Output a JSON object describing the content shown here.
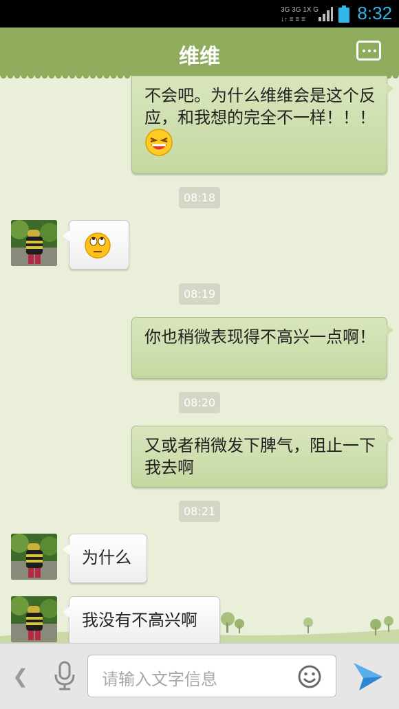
{
  "status_bar": {
    "network_label_top": "3G 3G 1X G",
    "time": "8:32"
  },
  "header": {
    "title": "维维",
    "menu_icon": "more-dots-icon"
  },
  "messages": [
    {
      "type": "outgoing",
      "text": "不会吧。为什么维维会是这个反应，和我想的完全不一样！！！",
      "emoji": "laughing-emoji"
    },
    {
      "type": "timestamp",
      "text": "08:18"
    },
    {
      "type": "incoming",
      "emoji": "eye-roll-emoji"
    },
    {
      "type": "timestamp",
      "text": "08:19"
    },
    {
      "type": "outgoing",
      "text": "你也稍微表现得不高兴一点啊！"
    },
    {
      "type": "timestamp",
      "text": "08:20"
    },
    {
      "type": "outgoing",
      "text": "又或者稍微发下脾气，阻止一下我去啊"
    },
    {
      "type": "timestamp",
      "text": "08:21"
    },
    {
      "type": "incoming",
      "text": "为什么"
    },
    {
      "type": "incoming",
      "text": "我没有不高兴啊"
    }
  ],
  "input_bar": {
    "placeholder": "请输入文字信息",
    "back_icon": "chevron-left-icon",
    "voice_icon": "microphone-icon",
    "emoji_icon": "smiley-icon",
    "send_icon": "send-arrow-icon"
  },
  "colors": {
    "header_bg": "#8fac5c",
    "chat_bg": "#e9efd9",
    "outgoing_bubble": "#cfdfae",
    "incoming_bubble": "#ffffff",
    "clock": "#33b5e5"
  }
}
